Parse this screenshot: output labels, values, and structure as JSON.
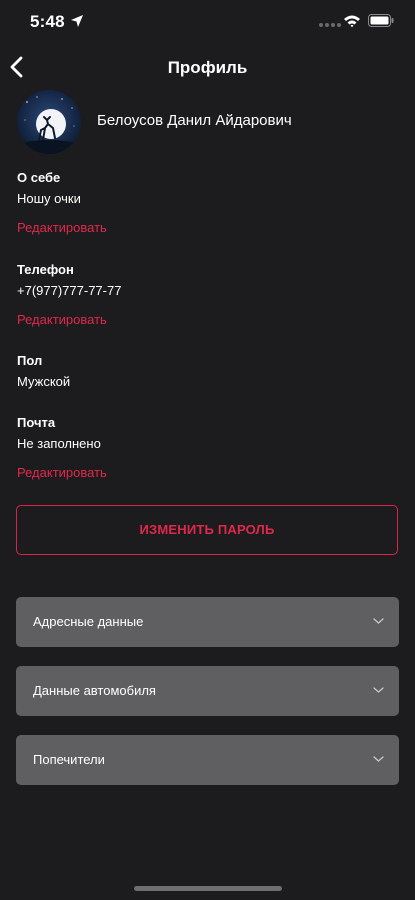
{
  "status_bar": {
    "time": "5:48",
    "icons": [
      "location-arrow-icon",
      "signal-icon",
      "wifi-icon",
      "battery-icon"
    ]
  },
  "header": {
    "title": "Профиль",
    "back_icon": "chevron-left-icon"
  },
  "profile": {
    "name": "Белоусов Данил Айдарович",
    "avatar": "night-sky-deer-moon-avatar"
  },
  "fields": {
    "about": {
      "label": "О себе",
      "value": "Ношу очки",
      "edit": "Редактировать"
    },
    "phone": {
      "label": "Телефон",
      "value": "+7(977)777-77-77",
      "edit": "Редактировать"
    },
    "gender": {
      "label": "Пол",
      "value": "Мужской"
    },
    "email": {
      "label": "Почта",
      "value": "Не заполнено",
      "edit": "Редактировать"
    }
  },
  "change_password_label": "ИЗМЕНИТЬ ПАРОЛЬ",
  "sections": [
    {
      "label": "Адресные данные"
    },
    {
      "label": "Данные автомобиля"
    },
    {
      "label": "Попечители"
    }
  ],
  "colors": {
    "background": "#1c1c1e",
    "accent": "#e0284c",
    "accordion": "#5f5f61"
  }
}
